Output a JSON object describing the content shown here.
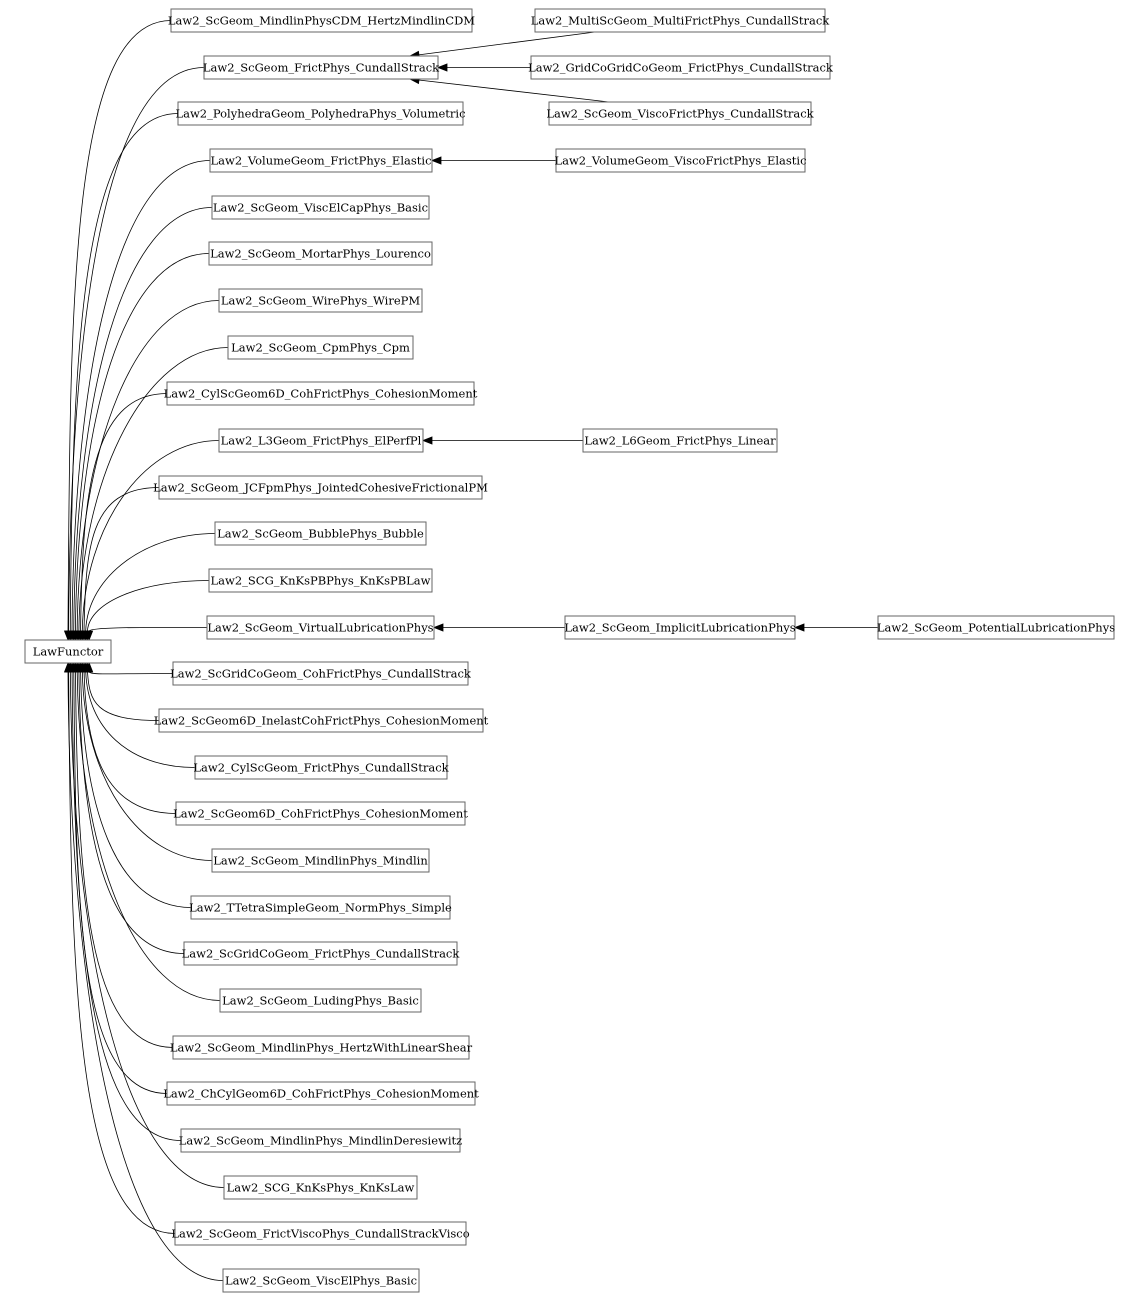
{
  "diagram": {
    "type": "inheritance-graph",
    "root": "LawFunctor",
    "nodes": [
      {
        "id": "LawFunctor",
        "label": "LawFunctor"
      },
      {
        "id": "n1",
        "label": "Law2_ScGeom_MindlinPhysCDM_HertzMindlinCDM"
      },
      {
        "id": "n2",
        "label": "Law2_ScGeom_FrictPhys_CundallStrack"
      },
      {
        "id": "n3",
        "label": "Law2_PolyhedraGeom_PolyhedraPhys_Volumetric"
      },
      {
        "id": "n4",
        "label": "Law2_VolumeGeom_FrictPhys_Elastic"
      },
      {
        "id": "n5",
        "label": "Law2_ScGeom_ViscElCapPhys_Basic"
      },
      {
        "id": "n6",
        "label": "Law2_ScGeom_MortarPhys_Lourenco"
      },
      {
        "id": "n7",
        "label": "Law2_ScGeom_WirePhys_WirePM"
      },
      {
        "id": "n8",
        "label": "Law2_ScGeom_CpmPhys_Cpm"
      },
      {
        "id": "n9",
        "label": "Law2_CylScGeom6D_CohFrictPhys_CohesionMoment"
      },
      {
        "id": "n10",
        "label": "Law2_L3Geom_FrictPhys_ElPerfPl"
      },
      {
        "id": "n11",
        "label": "Law2_ScGeom_JCFpmPhys_JointedCohesiveFrictionalPM"
      },
      {
        "id": "n12",
        "label": "Law2_ScGeom_BubblePhys_Bubble"
      },
      {
        "id": "n13",
        "label": "Law2_SCG_KnKsPBPhys_KnKsPBLaw"
      },
      {
        "id": "n14",
        "label": "Law2_ScGeom_VirtualLubricationPhys"
      },
      {
        "id": "n15",
        "label": "Law2_ScGridCoGeom_CohFrictPhys_CundallStrack"
      },
      {
        "id": "n16",
        "label": "Law2_ScGeom6D_InelastCohFrictPhys_CohesionMoment"
      },
      {
        "id": "n17",
        "label": "Law2_CylScGeom_FrictPhys_CundallStrack"
      },
      {
        "id": "n18",
        "label": "Law2_ScGeom6D_CohFrictPhys_CohesionMoment"
      },
      {
        "id": "n19",
        "label": "Law2_ScGeom_MindlinPhys_Mindlin"
      },
      {
        "id": "n20",
        "label": "Law2_TTetraSimpleGeom_NormPhys_Simple"
      },
      {
        "id": "n21",
        "label": "Law2_ScGridCoGeom_FrictPhys_CundallStrack"
      },
      {
        "id": "n22",
        "label": "Law2_ScGeom_LudingPhys_Basic"
      },
      {
        "id": "n23",
        "label": "Law2_ScGeom_MindlinPhys_HertzWithLinearShear"
      },
      {
        "id": "n24",
        "label": "Law2_ChCylGeom6D_CohFrictPhys_CohesionMoment"
      },
      {
        "id": "n25",
        "label": "Law2_ScGeom_MindlinPhys_MindlinDeresiewitz"
      },
      {
        "id": "n26",
        "label": "Law2_SCG_KnKsPhys_KnKsLaw"
      },
      {
        "id": "n27",
        "label": "Law2_ScGeom_FrictViscoPhys_CundallStrackVisco"
      },
      {
        "id": "n28",
        "label": "Law2_ScGeom_ViscElPhys_Basic"
      },
      {
        "id": "m1",
        "label": "Law2_MultiScGeom_MultiFrictPhys_CundallStrack"
      },
      {
        "id": "m2",
        "label": "Law2_GridCoGridCoGeom_FrictPhys_CundallStrack"
      },
      {
        "id": "m3",
        "label": "Law2_ScGeom_ViscoFrictPhys_CundallStrack"
      },
      {
        "id": "m4",
        "label": "Law2_VolumeGeom_ViscoFrictPhys_Elastic"
      },
      {
        "id": "m5",
        "label": "Law2_L6Geom_FrictPhys_Linear"
      },
      {
        "id": "m6",
        "label": "Law2_ScGeom_ImplicitLubricationPhys"
      },
      {
        "id": "m7",
        "label": "Law2_ScGeom_PotentialLubricationPhys"
      }
    ],
    "edges": [
      {
        "from": "n1",
        "to": "LawFunctor"
      },
      {
        "from": "n2",
        "to": "LawFunctor"
      },
      {
        "from": "n3",
        "to": "LawFunctor"
      },
      {
        "from": "n4",
        "to": "LawFunctor"
      },
      {
        "from": "n5",
        "to": "LawFunctor"
      },
      {
        "from": "n6",
        "to": "LawFunctor"
      },
      {
        "from": "n7",
        "to": "LawFunctor"
      },
      {
        "from": "n8",
        "to": "LawFunctor"
      },
      {
        "from": "n9",
        "to": "LawFunctor"
      },
      {
        "from": "n10",
        "to": "LawFunctor"
      },
      {
        "from": "n11",
        "to": "LawFunctor"
      },
      {
        "from": "n12",
        "to": "LawFunctor"
      },
      {
        "from": "n13",
        "to": "LawFunctor"
      },
      {
        "from": "n14",
        "to": "LawFunctor"
      },
      {
        "from": "n15",
        "to": "LawFunctor"
      },
      {
        "from": "n16",
        "to": "LawFunctor"
      },
      {
        "from": "n17",
        "to": "LawFunctor"
      },
      {
        "from": "n18",
        "to": "LawFunctor"
      },
      {
        "from": "n19",
        "to": "LawFunctor"
      },
      {
        "from": "n20",
        "to": "LawFunctor"
      },
      {
        "from": "n21",
        "to": "LawFunctor"
      },
      {
        "from": "n22",
        "to": "LawFunctor"
      },
      {
        "from": "n23",
        "to": "LawFunctor"
      },
      {
        "from": "n24",
        "to": "LawFunctor"
      },
      {
        "from": "n25",
        "to": "LawFunctor"
      },
      {
        "from": "n26",
        "to": "LawFunctor"
      },
      {
        "from": "n27",
        "to": "LawFunctor"
      },
      {
        "from": "n28",
        "to": "LawFunctor"
      },
      {
        "from": "m1",
        "to": "n2"
      },
      {
        "from": "m2",
        "to": "n2"
      },
      {
        "from": "m3",
        "to": "n2"
      },
      {
        "from": "m4",
        "to": "n4"
      },
      {
        "from": "m5",
        "to": "n10"
      },
      {
        "from": "m6",
        "to": "n14"
      },
      {
        "from": "m7",
        "to": "m6"
      }
    ]
  }
}
